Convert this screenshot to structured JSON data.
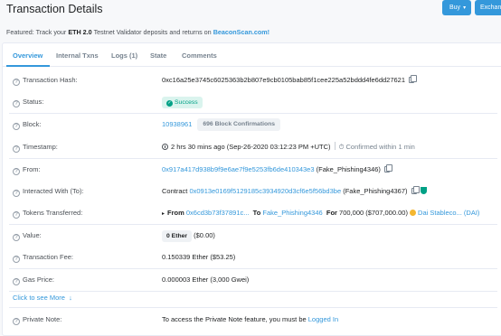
{
  "header": {
    "title": "Transaction Details",
    "buy_label": "Buy",
    "exchange_label": "Exchang"
  },
  "featured": {
    "prefix": "Featured: Track your",
    "bold": "ETH 2.0",
    "middle": "Testnet Validator deposits and returns on",
    "link": "BeaconScan.com!"
  },
  "tabs": [
    "Overview",
    "Internal Txns",
    "Logs (1)",
    "State",
    "Comments"
  ],
  "rows": {
    "hash": {
      "label": "Transaction Hash:",
      "value": "0xc16a25e3745c6025363b2b807e9cb0105bab85f1cee225a52bddd4fe6dd27621"
    },
    "status": {
      "label": "Status:",
      "value": "Success"
    },
    "block": {
      "label": "Block:",
      "number": "10938961",
      "confirmations": "696 Block Confirmations"
    },
    "timestamp": {
      "label": "Timestamp:",
      "ago": "2 hrs 30 mins ago (Sep-26-2020 03:12:23 PM +UTC)",
      "confirmed": "Confirmed within 1 min"
    },
    "from": {
      "label": "From:",
      "address": "0x917a417d938b9f9e6ae7f9e5253fb6de410343e3",
      "name": "(Fake_Phishing4346)"
    },
    "interacted": {
      "label": "Interacted With (To):",
      "prefix": "Contract",
      "address": "0x0913e0169f5129185c3934920d3cf6e5f56bd3be",
      "name": "(Fake_Phishing4367)"
    },
    "tokens": {
      "label": "Tokens Transferred:",
      "from_label": "From",
      "from_addr": "0x6cd3b73f37891c...",
      "to_label": "To",
      "to_addr": "Fake_Phishing4346",
      "for_label": "For",
      "amount": "700,000 ($707,000.00)",
      "token": "Dai Stableco...",
      "symbol": "(DAI)"
    },
    "value": {
      "label": "Value:",
      "ether": "0 Ether",
      "usd": "($0.00)"
    },
    "fee": {
      "label": "Transaction Fee:",
      "value": "0.150339 Ether ($53.25)"
    },
    "gas": {
      "label": "Gas Price:",
      "value": "0.000003 Ether (3,000 Gwei)"
    },
    "see_more": "Click to see More",
    "note": {
      "label": "Private Note:",
      "prefix": "To access the Private Note feature, you must be",
      "link": "Logged In"
    }
  },
  "colors": {
    "accent": "#3498db",
    "success": "#00a186",
    "token": "#f4b731"
  }
}
